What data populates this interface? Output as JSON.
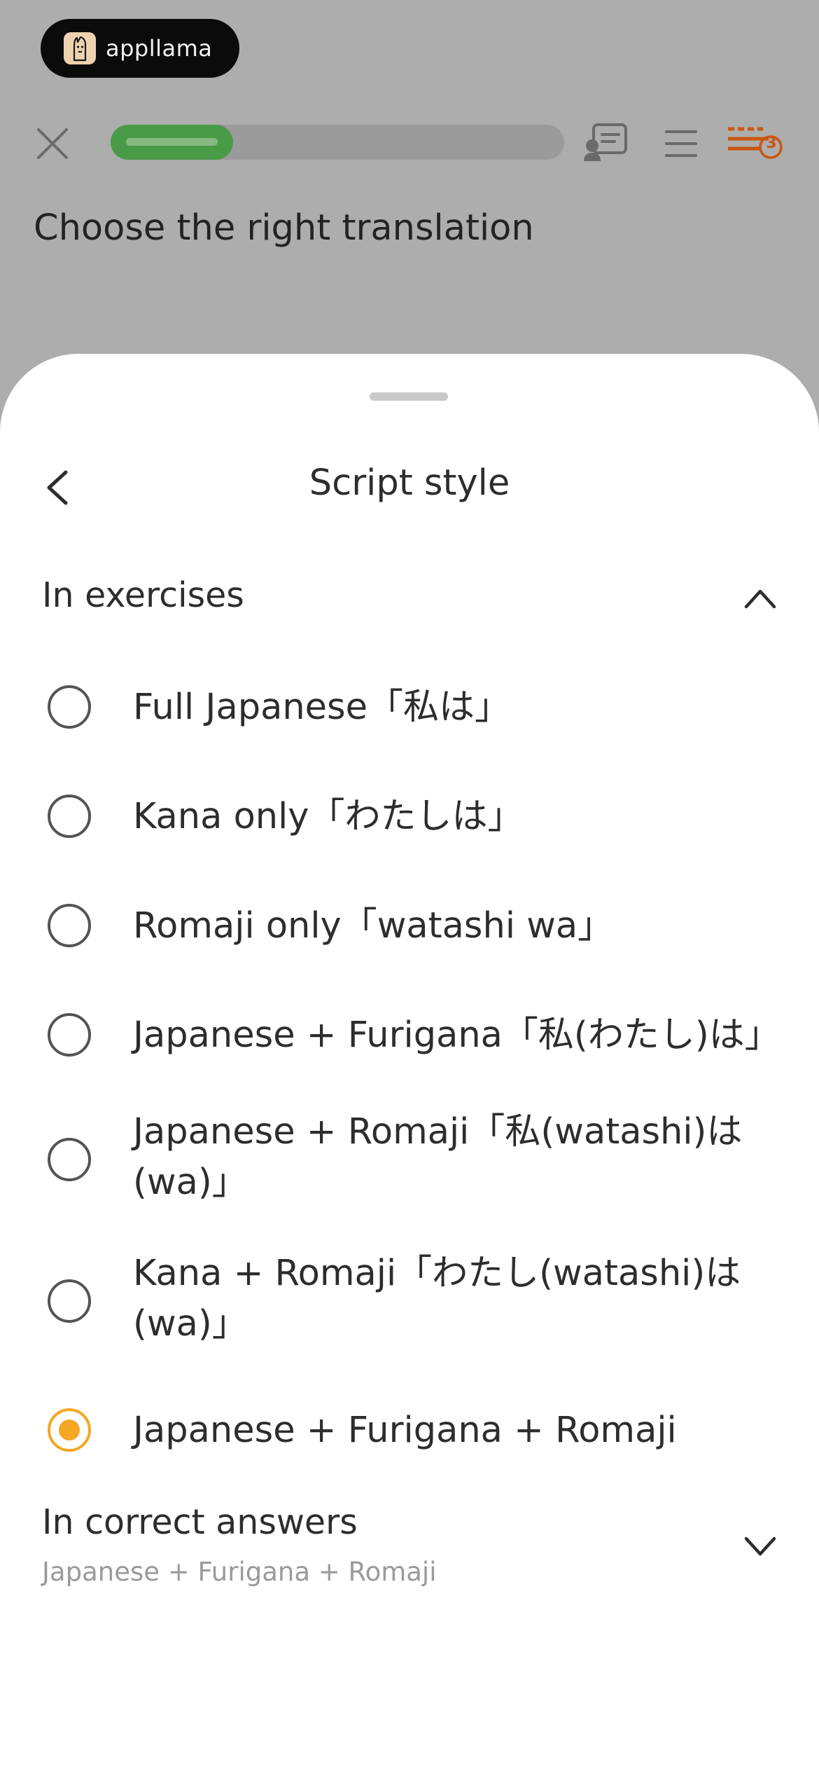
{
  "header": {
    "logo_text": "appllama",
    "progress_percent": 27,
    "notes_badge_count": "3",
    "question": "Choose the right translation"
  },
  "sheet": {
    "title": "Script style",
    "sections": {
      "exercises": {
        "label": "In exercises",
        "expanded": true,
        "options": [
          {
            "label": "Full Japanese「私は」",
            "selected": false
          },
          {
            "label": "Kana only「わたしは」",
            "selected": false
          },
          {
            "label": "Romaji only「watashi wa」",
            "selected": false
          },
          {
            "label": "Japanese + Furigana「私(わたし)は」",
            "selected": false
          },
          {
            "label": "Japanese + Romaji「私(watashi)は(wa)」",
            "selected": false
          },
          {
            "label": "Kana + Romaji「わたし(watashi)は(wa)」",
            "selected": false
          },
          {
            "label": "Japanese + Furigana + Romaji",
            "selected": true
          }
        ]
      },
      "answers": {
        "label": "In correct answers",
        "value": "Japanese + Furigana + Romaji",
        "expanded": false
      }
    }
  },
  "colors": {
    "accent": "#f5a623",
    "progress": "#4a9b47",
    "notes_icon": "#c9560f"
  },
  "icons": {
    "close": "close-icon",
    "flashcard": "flashcard-icon",
    "menu": "menu-icon",
    "notes": "notes-icon",
    "back": "chevron-left-icon",
    "collapse": "chevron-up-icon",
    "expand": "chevron-down-icon"
  }
}
